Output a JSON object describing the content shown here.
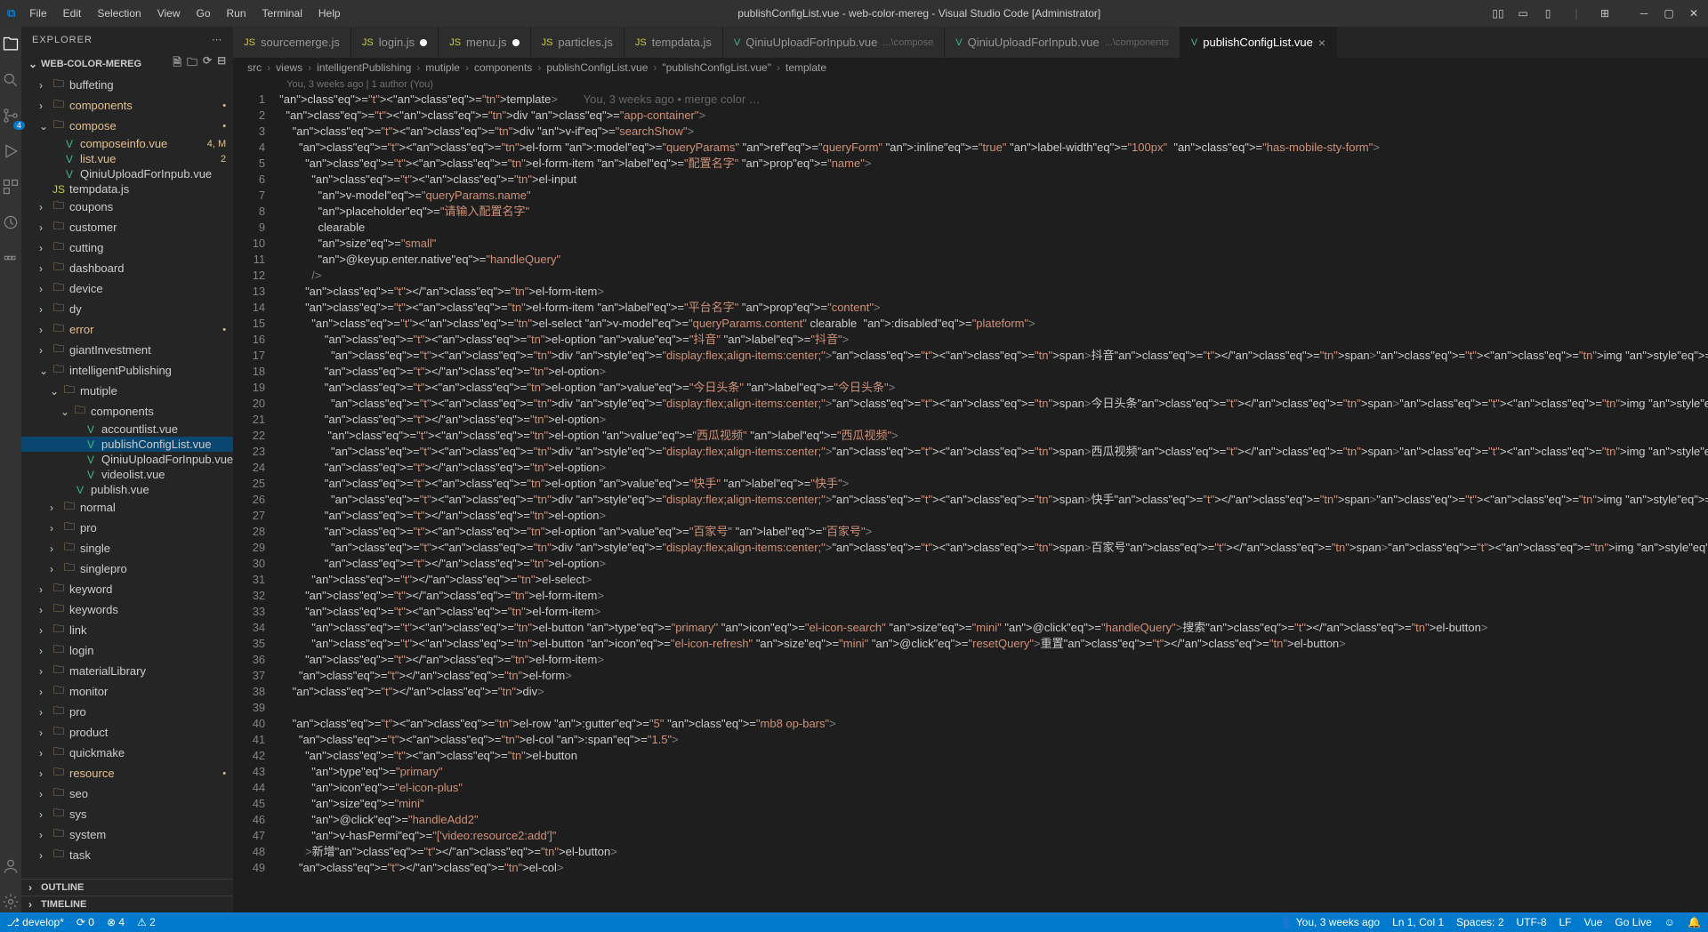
{
  "title": "publishConfigList.vue - web-color-mereg - Visual Studio Code [Administrator]",
  "menu": [
    "File",
    "Edit",
    "Selection",
    "View",
    "Go",
    "Run",
    "Terminal",
    "Help"
  ],
  "explorer": {
    "title": "EXPLORER",
    "project": "WEB-COLOR-MEREG",
    "outline": "OUTLINE",
    "timeline": "TIMELINE"
  },
  "sidebar_items": [
    {
      "d": 1,
      "t": "folder",
      "l": "buffeting",
      "c": false,
      "go": ""
    },
    {
      "d": 1,
      "t": "folder",
      "l": "components",
      "c": false,
      "go": "•",
      "cl": "fi-git"
    },
    {
      "d": 1,
      "t": "folder",
      "l": "compose",
      "c": true,
      "go": "•",
      "cl": "fi-git"
    },
    {
      "d": 2,
      "t": "vue",
      "l": "composeinfo.vue",
      "go": "4, M",
      "cl": "fi-mod"
    },
    {
      "d": 2,
      "t": "vue",
      "l": "list.vue",
      "go": "2",
      "cl": "fi-mod"
    },
    {
      "d": 2,
      "t": "vue",
      "l": "QiniuUploadForInpub.vue"
    },
    {
      "d": 1,
      "t": "js",
      "l": "tempdata.js"
    },
    {
      "d": 1,
      "t": "folder",
      "l": "coupons",
      "c": false
    },
    {
      "d": 1,
      "t": "folder",
      "l": "customer",
      "c": false
    },
    {
      "d": 1,
      "t": "folder",
      "l": "cutting",
      "c": false
    },
    {
      "d": 1,
      "t": "folder",
      "l": "dashboard",
      "c": false
    },
    {
      "d": 1,
      "t": "folder",
      "l": "device",
      "c": false
    },
    {
      "d": 1,
      "t": "folder",
      "l": "dy",
      "c": false
    },
    {
      "d": 1,
      "t": "folder",
      "l": "error",
      "c": false,
      "go": "•",
      "cl": "fi-git"
    },
    {
      "d": 1,
      "t": "folder",
      "l": "giantInvestment",
      "c": false
    },
    {
      "d": 1,
      "t": "folder",
      "l": "intelligentPublishing",
      "c": true
    },
    {
      "d": 2,
      "t": "folder",
      "l": "mutiple",
      "c": true
    },
    {
      "d": 3,
      "t": "folder",
      "l": "components",
      "c": true
    },
    {
      "d": 4,
      "t": "vue",
      "l": "accountlist.vue"
    },
    {
      "d": 4,
      "t": "vue",
      "l": "publishConfigList.vue",
      "sel": true
    },
    {
      "d": 4,
      "t": "vue",
      "l": "QiniuUploadForInpub.vue"
    },
    {
      "d": 4,
      "t": "vue",
      "l": "videolist.vue"
    },
    {
      "d": 3,
      "t": "vue",
      "l": "publish.vue"
    },
    {
      "d": 2,
      "t": "folder",
      "l": "normal",
      "c": false
    },
    {
      "d": 2,
      "t": "folder",
      "l": "pro",
      "c": false
    },
    {
      "d": 2,
      "t": "folder",
      "l": "single",
      "c": false
    },
    {
      "d": 2,
      "t": "folder",
      "l": "singlepro",
      "c": false
    },
    {
      "d": 1,
      "t": "folder",
      "l": "keyword",
      "c": false
    },
    {
      "d": 1,
      "t": "folder",
      "l": "keywords",
      "c": false
    },
    {
      "d": 1,
      "t": "folder",
      "l": "link",
      "c": false
    },
    {
      "d": 1,
      "t": "folder",
      "l": "login",
      "c": false
    },
    {
      "d": 1,
      "t": "folder",
      "l": "materialLibrary",
      "c": false
    },
    {
      "d": 1,
      "t": "folder",
      "l": "monitor",
      "c": false
    },
    {
      "d": 1,
      "t": "folder",
      "l": "pro",
      "c": false
    },
    {
      "d": 1,
      "t": "folder",
      "l": "product",
      "c": false
    },
    {
      "d": 1,
      "t": "folder",
      "l": "quickmake",
      "c": false
    },
    {
      "d": 1,
      "t": "folder",
      "l": "resource",
      "c": false,
      "go": "•",
      "cl": "fi-git"
    },
    {
      "d": 1,
      "t": "folder",
      "l": "seo",
      "c": false
    },
    {
      "d": 1,
      "t": "folder",
      "l": "sys",
      "c": false
    },
    {
      "d": 1,
      "t": "folder",
      "l": "system",
      "c": false
    },
    {
      "d": 1,
      "t": "folder",
      "l": "task",
      "c": false
    }
  ],
  "tabs": [
    {
      "l": "sourcemerge.js",
      "i": "js"
    },
    {
      "l": "login.js",
      "i": "js",
      "mod": true
    },
    {
      "l": "menu.js",
      "i": "js",
      "mod": true
    },
    {
      "l": "particles.js",
      "i": "js"
    },
    {
      "l": "tempdata.js",
      "i": "js"
    },
    {
      "l": "QiniuUploadForInpub.vue",
      "sub": "...\\compose",
      "i": "vue"
    },
    {
      "l": "QiniuUploadForInpub.vue",
      "sub": "...\\components",
      "i": "vue"
    },
    {
      "l": "publishConfigList.vue",
      "i": "vue",
      "active": true
    }
  ],
  "breadcrumbs": [
    "src",
    "views",
    "intelligentPublishing",
    "mutiple",
    "components",
    "publishConfigList.vue",
    "\"publishConfigList.vue\"",
    "template"
  ],
  "author_line": "You, 3 weeks ago | 1 author (You)",
  "gitlens_inline": "You, 3 weeks ago • merge color …",
  "code_lines": [
    "<template>",
    "  <div class=\"app-container\">",
    "    <div v-if=\"searchShow\">",
    "      <el-form :model=\"queryParams\" ref=\"queryForm\" :inline=\"true\" label-width=\"100px\"  class=\"has-mobile-sty-form\">",
    "        <el-form-item label=\"配置名字\" prop=\"name\">",
    "          <el-input",
    "            v-model=\"queryParams.name\"",
    "            placeholder=\"请输入配置名字\"",
    "            clearable",
    "            size=\"small\"",
    "            @keyup.enter.native=\"handleQuery\"",
    "          />",
    "        </el-form-item>",
    "        <el-form-item label=\"平台名字\" prop=\"content\">",
    "          <el-select v-model=\"queryParams.content\" clearable  :disabled=\"plateform\">",
    "              <el-option value=\"抖音\" label=\"抖音\">",
    "                <div style=\"display:flex;align-items:center;\"><span>抖音</span><img style=\"width:20px;height:20px;margin-left:10px;\" src=\"http://jk",
    "              </el-option>",
    "              <el-option value=\"今日头条\" label=\"今日头条\">",
    "                <div style=\"display:flex;align-items:center;\"><span>今日头条</span><img style=\"width:20px;height:20px;margin-left:10px;\" src=\"http:/",
    "              </el-option>",
    "               <el-option value=\"西瓜视频\" label=\"西瓜视频\">",
    "                <div style=\"display:flex;align-items:center;\"><span>西瓜视频</span><img style=\"width:20px;height:20px;margin-left:10px;\" src=\"http:/",
    "              </el-option>",
    "              <el-option value=\"快手\" label=\"快手\">",
    "                <div style=\"display:flex;align-items:center;\"><span>快手</span><img style=\"width:20px;height:20px;margin-left:10px;\" src=\"http://qn",
    "              </el-option>",
    "              <el-option value=\"百家号\" label=\"百家号\">",
    "                <div style=\"display:flex;align-items:center;\"><span>百家号</span><img style=\"width:20px;height:20px;margin-left:10px;\" src=\"http://c",
    "              </el-option>",
    "          </el-select>",
    "        </el-form-item>",
    "        <el-form-item>",
    "          <el-button type=\"primary\" icon=\"el-icon-search\" size=\"mini\" @click=\"handleQuery\">搜索</el-button>",
    "          <el-button icon=\"el-icon-refresh\" size=\"mini\" @click=\"resetQuery\">重置</el-button>",
    "        </el-form-item>",
    "      </el-form>",
    "    </div>",
    "",
    "    <el-row :gutter=\"5\" class=\"mb8 op-bars\">",
    "      <el-col :span=\"1.5\">",
    "        <el-button",
    "          type=\"primary\"",
    "          icon=\"el-icon-plus\"",
    "          size=\"mini\"",
    "          @click=\"handleAdd2\"",
    "          v-hasPermi=\"['video:resource2:add']\"",
    "        >新增</el-button>",
    "      </el-col>"
  ],
  "status": {
    "branch": "develop*",
    "sync": "⟳ 0",
    "err": "⊗ 4",
    "warn": "⚠ 2",
    "blame": "You, 3 weeks ago",
    "spaces": "Spaces: 2",
    "encoding": "UTF-8",
    "eol": "LF",
    "lang": "Vue",
    "pos": "Ln 1, Col 1",
    "golive": "Go Live",
    "bell": "🔔"
  },
  "scm_badge": "4"
}
